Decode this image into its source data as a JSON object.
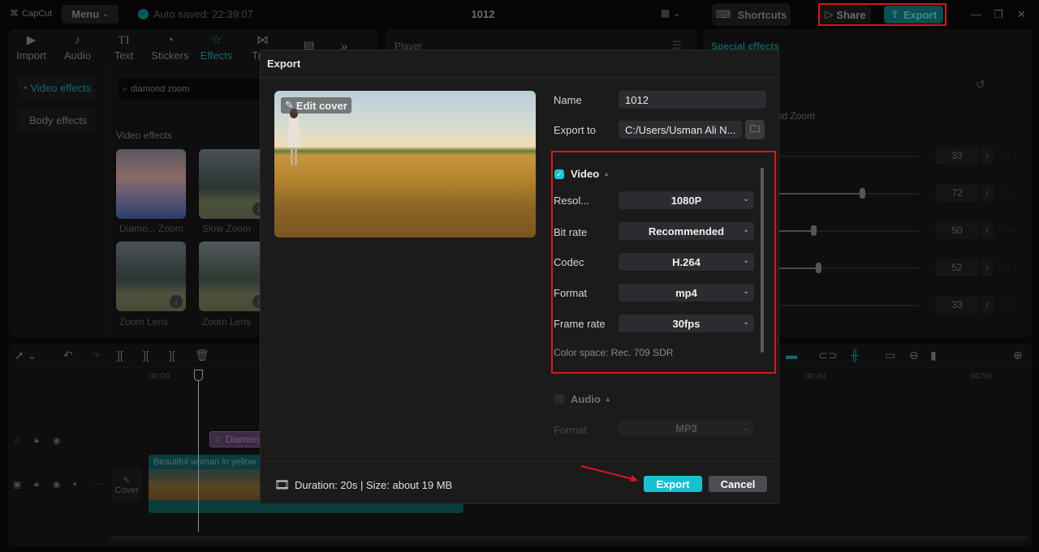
{
  "app": {
    "logo_text": "CapCut",
    "menu_label": "Menu",
    "autosave_text": "Auto saved: 22:39:07",
    "project_title": "1012",
    "shortcuts_label": "Shortcuts",
    "share_label": "Share",
    "export_label": "Export"
  },
  "media_panel": {
    "tabs": [
      {
        "label": "Import",
        "icon": "import-icon"
      },
      {
        "label": "Audio",
        "icon": "audio-icon"
      },
      {
        "label": "Text",
        "icon": "text-icon"
      },
      {
        "label": "Stickers",
        "icon": "stickers-icon"
      },
      {
        "label": "Effects",
        "icon": "effects-icon",
        "active": true
      },
      {
        "label": "Tran",
        "icon": "transitions-icon"
      },
      {
        "label": "",
        "icon": "captions-icon"
      }
    ],
    "side_nav": [
      {
        "label": "Video effects",
        "active": true
      },
      {
        "label": "Body effects"
      }
    ],
    "search_value": "diamond zoom",
    "section_label": "Video effects",
    "effects": [
      {
        "label": "Diamo... Zoom"
      },
      {
        "label": "Slow Zoom"
      },
      {
        "label": "Zoom Lens"
      },
      {
        "label": "Zoom Lens"
      }
    ]
  },
  "player": {
    "title": "Player"
  },
  "special_effects": {
    "title": "Special effects",
    "effect_name": "ond Zoom",
    "sliders": [
      {
        "value": 33
      },
      {
        "value": 72
      },
      {
        "value": 50
      },
      {
        "value": 52
      },
      {
        "value": 33
      }
    ]
  },
  "timeline": {
    "ruler": [
      "00:00",
      "00:40",
      "00:50"
    ],
    "effect_clip_label": "Diamond Zoom",
    "video_clip_label": "Beautiful woman in yellow",
    "cover_label": "Cover"
  },
  "export_dialog": {
    "title": "Export",
    "edit_cover_label": "Edit cover",
    "name_label": "Name",
    "name_value": "1012",
    "export_to_label": "Export to",
    "export_to_value": "C:/Users/Usman Ali N...",
    "video": {
      "label": "Video",
      "checked": true,
      "fields": [
        {
          "label": "Resol...",
          "value": "1080P"
        },
        {
          "label": "Bit rate",
          "value": "Recommended"
        },
        {
          "label": "Codec",
          "value": "H.264"
        },
        {
          "label": "Format",
          "value": "mp4"
        },
        {
          "label": "Frame rate",
          "value": "30fps"
        }
      ],
      "color_space": "Color space: Rec. 709 SDR"
    },
    "audio": {
      "label": "Audio",
      "checked": false,
      "format_label": "Format",
      "format_value": "MP3"
    },
    "footer_info": "Duration: 20s | Size: about 19 MB",
    "export_button": "Export",
    "cancel_button": "Cancel"
  },
  "colors": {
    "accent": "#17c2cf",
    "highlight_box": "#e0141c",
    "dialog_bg": "#1b1b1b"
  }
}
